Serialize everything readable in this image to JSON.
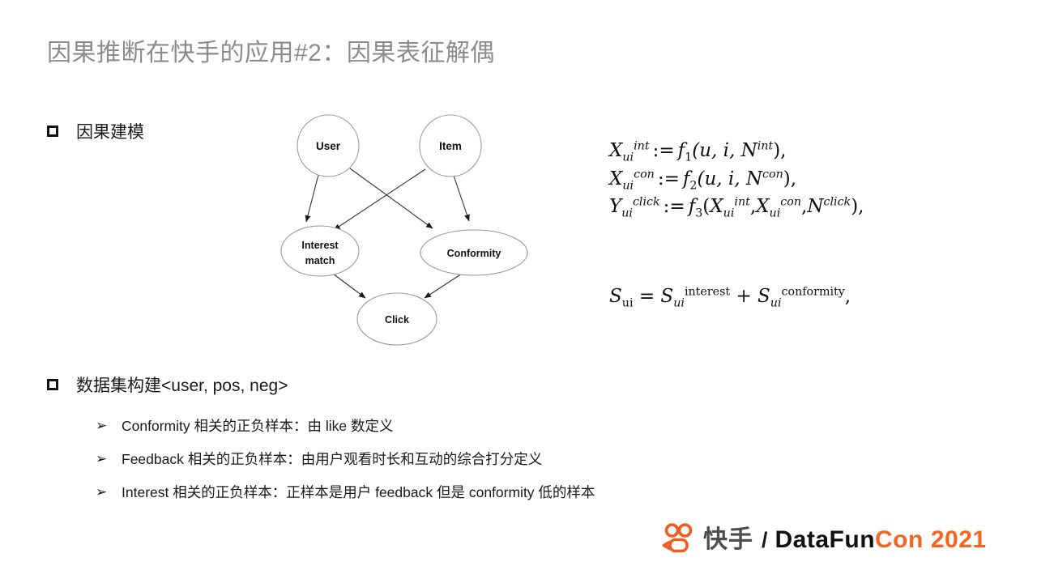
{
  "slide": {
    "title": "因果推断在快手的应用#2：因果表征解偶",
    "title_color": "#8c8c8c"
  },
  "bullets": [
    {
      "marker": "square",
      "text": "因果建模"
    },
    {
      "marker": "square",
      "text": "数据集构建<user, pos, neg>"
    }
  ],
  "sub_bullets": [
    {
      "marker": "➢",
      "text": "Conformity 相关的正负样本：由 like 数定义"
    },
    {
      "marker": "➢",
      "text": "Feedback 相关的正负样本：由用户观看时长和互动的综合打分定义"
    },
    {
      "marker": "➢",
      "text": "Interest 相关的正负样本：正样本是用户 feedback 但是 conformity 低的样本"
    }
  ],
  "diagram": {
    "nodes": {
      "user": "User",
      "item": "Item",
      "interest_line1": "Interest",
      "interest_line2": "match",
      "conformity": "Conformity",
      "click": "Click"
    },
    "edges": [
      {
        "from": "User",
        "to": "Interest match"
      },
      {
        "from": "User",
        "to": "Conformity"
      },
      {
        "from": "Item",
        "to": "Interest match"
      },
      {
        "from": "Item",
        "to": "Conformity"
      },
      {
        "from": "Interest match",
        "to": "Click"
      },
      {
        "from": "Conformity",
        "to": "Click"
      }
    ],
    "stroke_color": "#808080"
  },
  "formulas": {
    "sem": [
      "X_{ui}^{int} := f_1(u, i, N^{int}),",
      "X_{ui}^{con} := f_2(u, i, N^{con}),",
      "Y_{ui}^{click} := f_3(X_{ui}^{int}, X_{ui}^{con}, N^{click}),"
    ],
    "score": "S_ui = S_{ui}^{interest} + S_{ui}^{conformity},",
    "parts": {
      "X": "X",
      "Y": "Y",
      "S": "S",
      "N": "N",
      "f": "f",
      "sub_ui": "ui",
      "sup_int": "int",
      "sup_con": "con",
      "sup_click": "click",
      "sup_interest": "interest",
      "sup_conformity": "conformity",
      "assign": ":=",
      "equals": "=",
      "plus": "+",
      "idx1": "1",
      "idx2": "2",
      "idx3": "3",
      "args_ui": "(u, i,",
      "close_comma": "),",
      "open_paren": "(",
      "comma": ",",
      "trailing_comma": ","
    }
  },
  "footer": {
    "kuaishou_text": "快手",
    "separator": "/",
    "datafun_text": "DataFun",
    "con_text": "Con",
    "year_text": "2021",
    "brand_orange": "#f26522",
    "dark_gray": "#4d4d4d"
  }
}
